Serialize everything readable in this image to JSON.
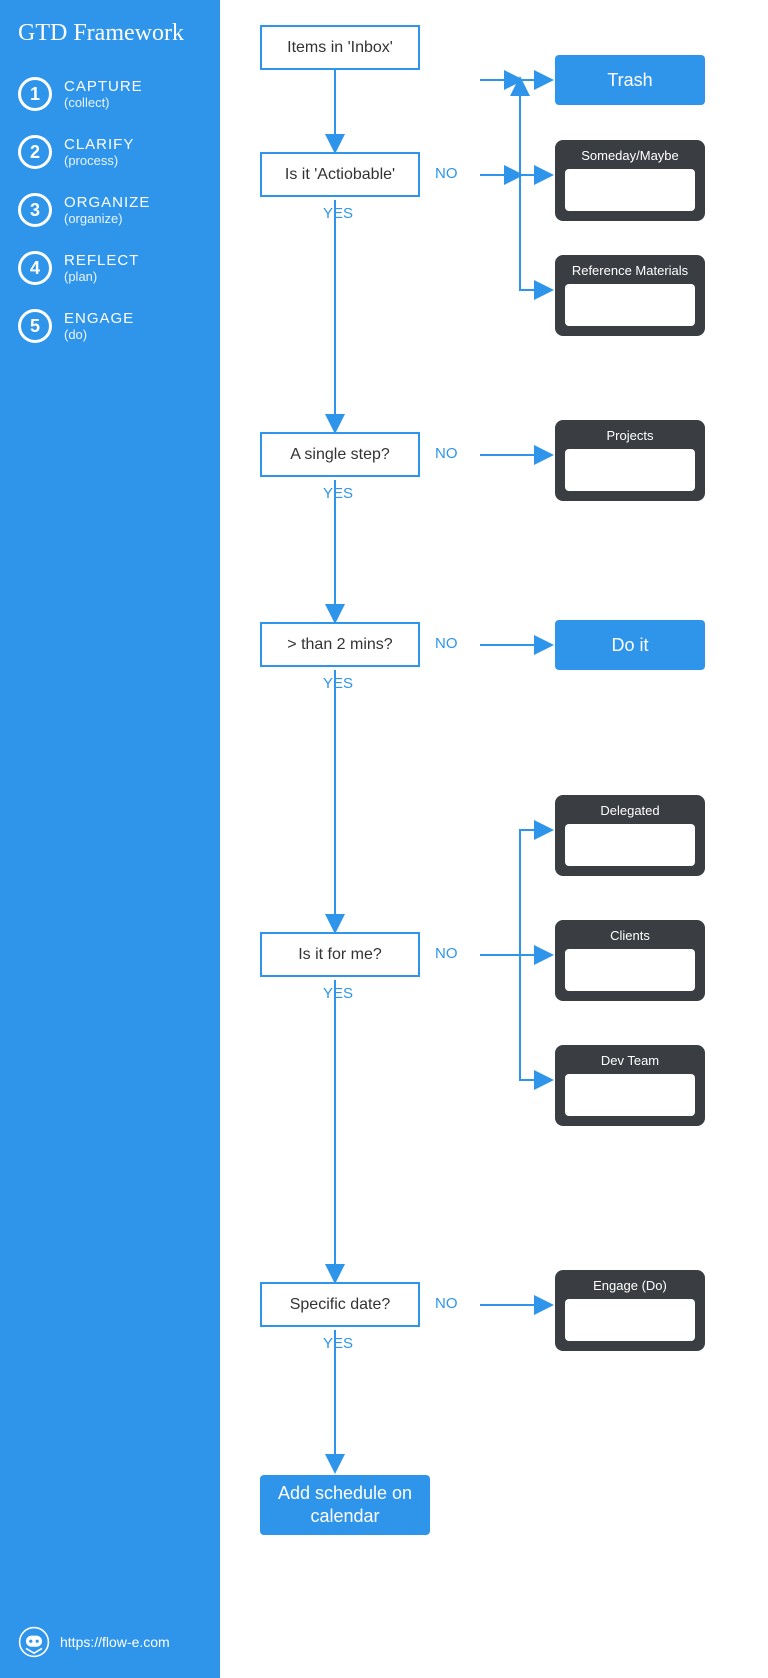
{
  "sidebar": {
    "title": "GTD Framework",
    "steps": [
      {
        "num": "1",
        "title": "CAPTURE",
        "sub": "(collect)"
      },
      {
        "num": "2",
        "title": "CLARIFY",
        "sub": "(process)"
      },
      {
        "num": "3",
        "title": "ORGANIZE",
        "sub": "(organize)"
      },
      {
        "num": "4",
        "title": "REFLECT",
        "sub": "(plan)"
      },
      {
        "num": "5",
        "title": "ENGAGE",
        "sub": "(do)"
      }
    ]
  },
  "footer_url": "https://flow-e.com",
  "labels": {
    "yes": "YES",
    "no": "NO"
  },
  "nodes": {
    "inbox": "Items in 'Inbox'",
    "actionable": "Is it 'Actiobable'",
    "single": "A single step?",
    "twomin": "> than 2 mins?",
    "forme": "Is it for me?",
    "date": "Specific date?",
    "trash": "Trash",
    "doit": "Do it",
    "calendar": "Add schedule on calendar"
  },
  "cards": {
    "someday": "Someday/Maybe",
    "ref": "Reference Materials",
    "projects": "Projects",
    "delegated": "Delegated",
    "clients": "Clients",
    "dev": "Dev Team",
    "engage": "Engage (Do)"
  }
}
